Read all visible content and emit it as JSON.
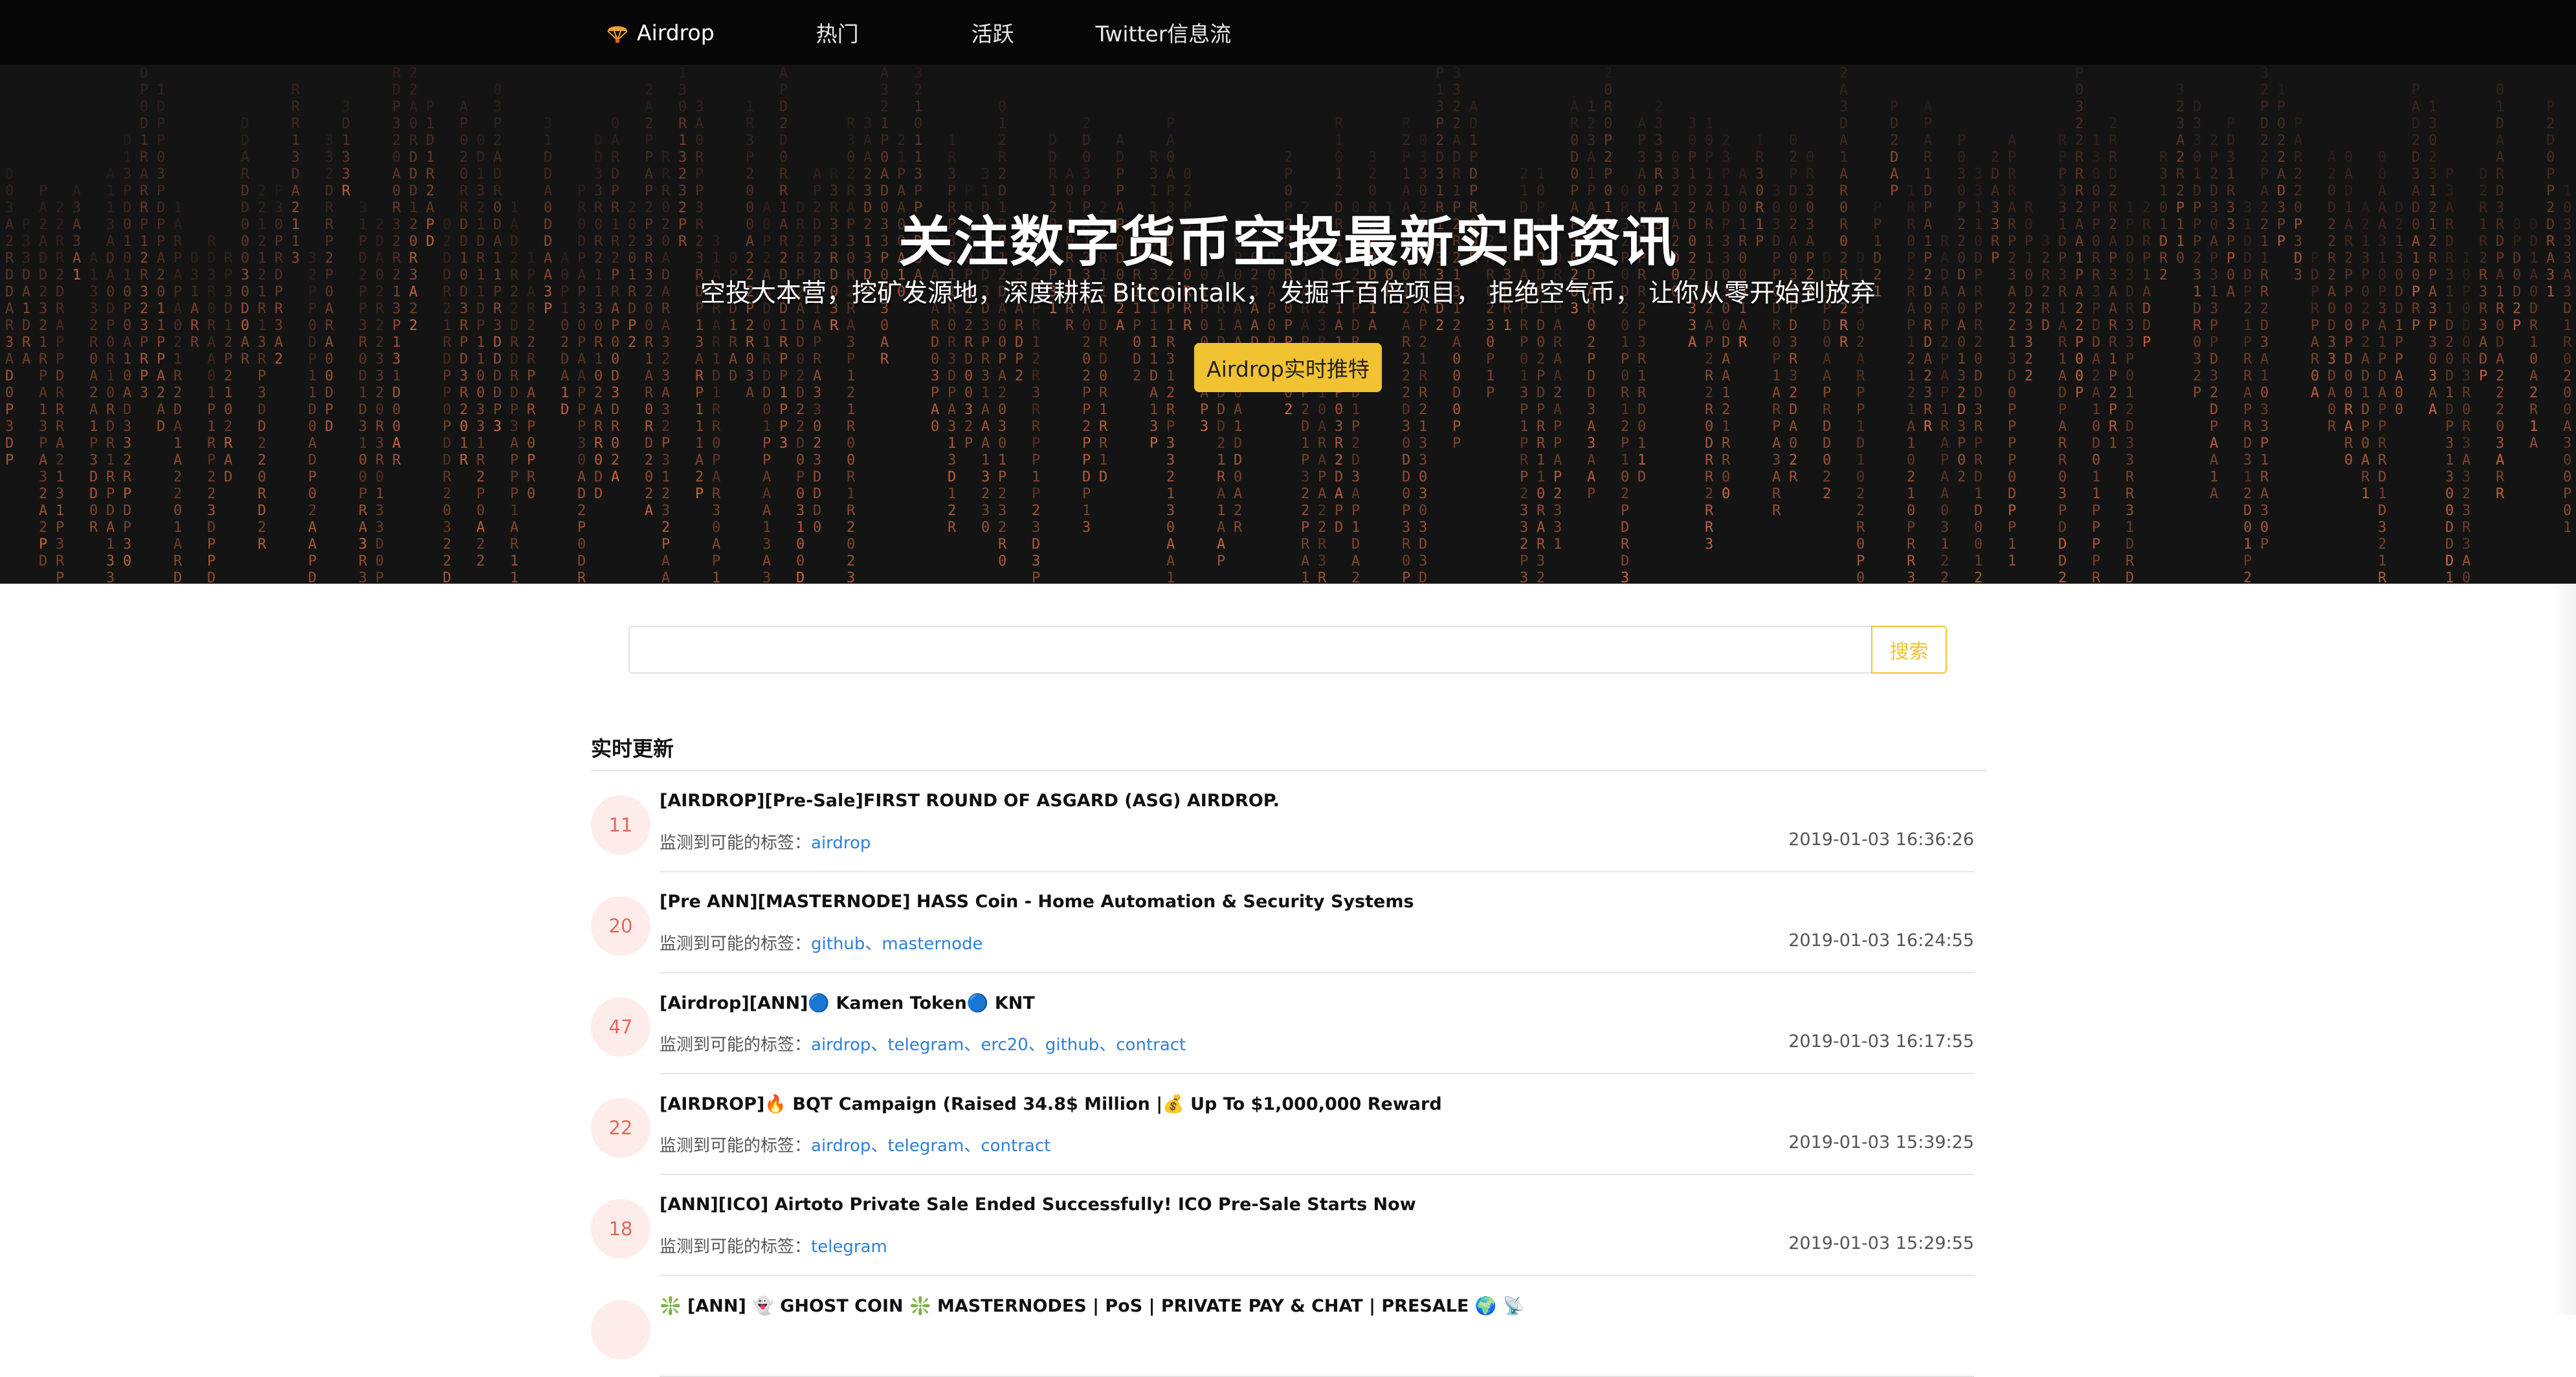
{
  "nav": {
    "brand": "Airdrop",
    "links": [
      "热门",
      "活跃",
      "Twitter信息流"
    ]
  },
  "hero": {
    "title": "关注数字货币空投最新实时资讯",
    "subtitle": "空投大本营，挖矿发源地，深度耕耘 Bitcointalk， 发掘千百倍项目， 拒绝空气币， 让你从零开始到放弃",
    "button": "Airdrop实时推特",
    "rain_chars": "RDPA0123",
    "rain_color": "#e8734a"
  },
  "search": {
    "placeholder": "",
    "button": "搜索"
  },
  "section_title": "实时更新",
  "tag_prefix": "监测到可能的标签：",
  "items": [
    {
      "count": "11",
      "title": "[AIRDROP][Pre-Sale]FIRST ROUND OF ASGARD (ASG) AIRDROP.",
      "tags": [
        "airdrop"
      ],
      "date": "2019-01-03 16:36:26"
    },
    {
      "count": "20",
      "title": "[Pre ANN][MASTERNODE] HASS Coin - Home Automation & Security Systems",
      "tags": [
        "github",
        "masternode"
      ],
      "date": "2019-01-03 16:24:55"
    },
    {
      "count": "47",
      "title": "[Airdrop][ANN]🔵 Kamen Token🔵 KNT",
      "tags": [
        "airdrop",
        "telegram",
        "erc20",
        "github",
        "contract"
      ],
      "date": "2019-01-03 16:17:55"
    },
    {
      "count": "22",
      "title": "[AIRDROP]🔥 BQT Campaign (Raised 34.8$ Million |💰 Up To $1,000,000 Reward",
      "tags": [
        "airdrop",
        "telegram",
        "contract"
      ],
      "date": "2019-01-03 15:39:25"
    },
    {
      "count": "18",
      "title": "[ANN][ICO] Airtoto Private Sale Ended Successfully! ICO Pre-Sale Starts Now",
      "tags": [
        "telegram"
      ],
      "date": "2019-01-03 15:29:55"
    },
    {
      "count": "",
      "title": "❇️ [ANN] 👻 GHOST COIN ❇️ MASTERNODES | PoS | PRIVATE PAY & CHAT | PRESALE 🌍 📡",
      "tags": [],
      "date": ""
    }
  ]
}
